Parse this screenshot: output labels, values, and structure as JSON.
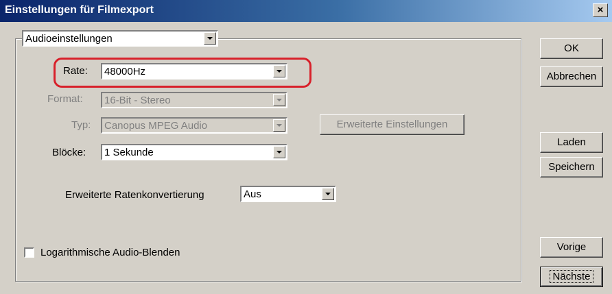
{
  "window": {
    "title": "Einstellungen für Filmexport",
    "close_glyph": "×"
  },
  "section_select": {
    "value": "Audioeinstellungen"
  },
  "fields": {
    "rate": {
      "label": "Rate:",
      "value": "48000Hz"
    },
    "format": {
      "label": "Format:",
      "value": "16-Bit - Stereo"
    },
    "typ": {
      "label": "Typ:",
      "value": "Canopus MPEG Audio"
    },
    "bloecke": {
      "label": "Blöcke:",
      "value": "1 Sekunde"
    }
  },
  "advanced_button": {
    "label": "Erweiterte Einstellungen"
  },
  "rate_conversion": {
    "label": "Erweiterte Ratenkonvertierung",
    "value": "Aus"
  },
  "checkbox": {
    "label": "Logarithmische Audio-Blenden",
    "checked": false
  },
  "buttons": {
    "ok": "OK",
    "cancel": "Abbrechen",
    "load": "Laden",
    "save": "Speichern",
    "previous": "Vorige",
    "next": "Nächste"
  },
  "colors": {
    "highlight": "#d8202a",
    "titlebar": "#0a246a",
    "dialog_bg": "#d4d0c8"
  }
}
